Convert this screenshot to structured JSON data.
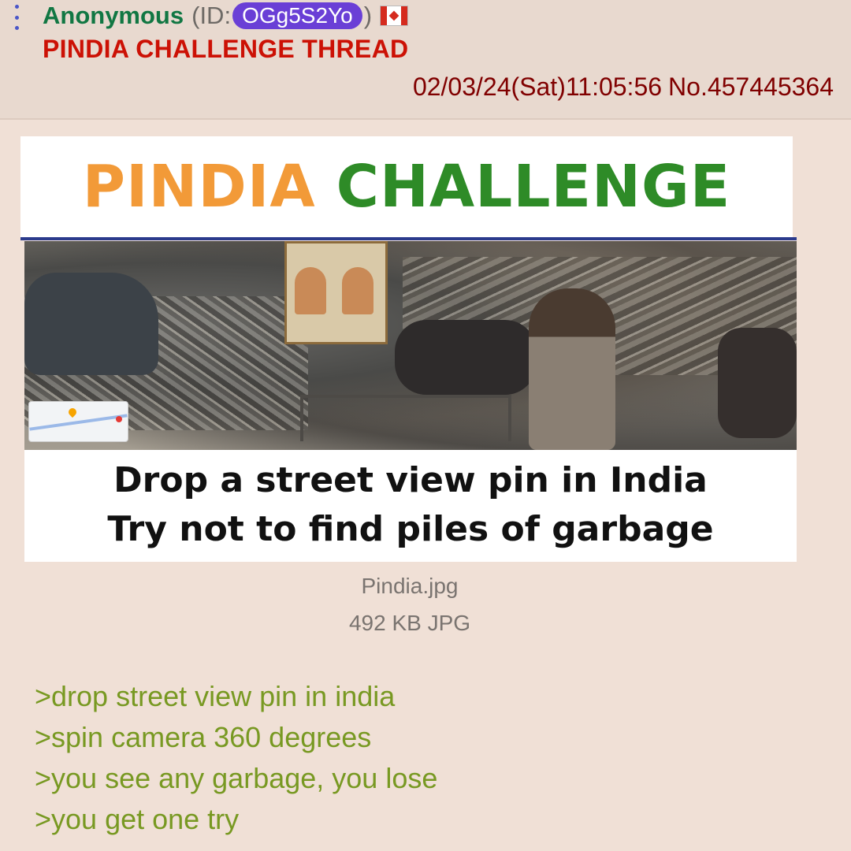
{
  "post": {
    "name": "Anonymous",
    "id_prefix": "(ID:",
    "id": "OGg5S2Yo",
    "id_suffix": ")",
    "flag": "canada-flag",
    "subject": "PINDIA CHALLENGE THREAD",
    "datetime": "02/03/24(Sat)11:05:56",
    "number": "No.457445364"
  },
  "image": {
    "banner_word1": "PINDIA",
    "banner_word2": "CHALLENGE",
    "caption_line1": "Drop a street view pin in India",
    "caption_line2": "Try not to find piles of garbage",
    "file_name": "Pindia.jpg",
    "file_info": "492 KB JPG"
  },
  "greentext": [
    ">drop street view pin in india",
    ">spin camera 360 degrees",
    ">you see any garbage, you lose",
    ">you get one try"
  ],
  "colors": {
    "background": "#f0e0d6",
    "name": "#117743",
    "subject": "#cc1105",
    "meta": "#800000",
    "greentext": "#789922",
    "id_pill": "#6a3fd6",
    "banner_orange": "#f29a38",
    "banner_green": "#2e8b27"
  }
}
